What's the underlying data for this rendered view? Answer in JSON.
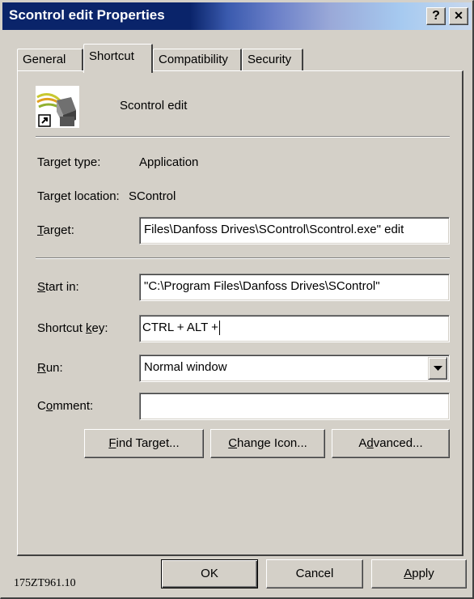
{
  "window": {
    "title": "Scontrol edit Properties",
    "help_btn": "?",
    "close_btn": "✕"
  },
  "tabs": [
    {
      "label": "General",
      "active": false
    },
    {
      "label": "Shortcut",
      "active": true
    },
    {
      "label": "Compatibility",
      "active": false
    },
    {
      "label": "Security",
      "active": false
    }
  ],
  "shortcut": {
    "icon": "scontrol-app-icon",
    "name": "Scontrol edit",
    "target_type_label": "Target type:",
    "target_type_value": "Application",
    "target_location_label": "Target location:",
    "target_location_value": "SControl",
    "target_label_pre": "",
    "target_label_u": "T",
    "target_label_post": "arget:",
    "target_value": "Files\\Danfoss Drives\\SControl\\Scontrol.exe\" edit",
    "start_in_label_u": "S",
    "start_in_label_post": "tart in:",
    "start_in_value": "\"C:\\Program Files\\Danfoss Drives\\SControl\"",
    "shortcut_key_label_pre": "Shortcut ",
    "shortcut_key_label_u": "k",
    "shortcut_key_label_post": "ey:",
    "shortcut_key_value": "CTRL + ALT +",
    "run_label_u": "R",
    "run_label_post": "un:",
    "run_value": "Normal window",
    "comment_label_pre": "C",
    "comment_label_u": "o",
    "comment_label_post": "mment:",
    "comment_value": ""
  },
  "buttons": {
    "find_target_u": "F",
    "find_target_post": "ind Target...",
    "change_icon_u": "C",
    "change_icon_post": "hange Icon...",
    "advanced_pre": "A",
    "advanced_u": "d",
    "advanced_post": "vanced...",
    "ok": "OK",
    "cancel": "Cancel",
    "apply_u": "A",
    "apply_post": "pply"
  },
  "caption": "175ZT961.10"
}
